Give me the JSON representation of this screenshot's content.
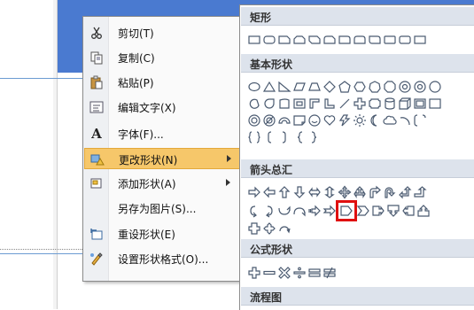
{
  "context_menu": {
    "items": [
      {
        "icon": "cut-icon",
        "label": "剪切(T)"
      },
      {
        "icon": "copy-icon",
        "label": "复制(C)"
      },
      {
        "icon": "paste-icon",
        "label": "粘贴(P)"
      },
      {
        "icon": "edit-text-icon",
        "label": "编辑文字(X)"
      },
      {
        "icon": "font-icon",
        "label": "字体(F)..."
      },
      {
        "icon": "change-shape-icon",
        "label": "更改形状(N)",
        "highlighted": true,
        "submenu": true
      },
      {
        "icon": "add-shape-icon",
        "label": "添加形状(A)",
        "submenu": true
      },
      {
        "icon": "",
        "label": "另存为图片(S)..."
      },
      {
        "icon": "reset-shape-icon",
        "label": "重设形状(E)"
      },
      {
        "icon": "format-shape-icon",
        "label": "设置形状格式(O)..."
      }
    ],
    "font_icon_glyph": "A"
  },
  "gallery": {
    "sections": [
      {
        "title": "矩形"
      },
      {
        "title": "基本形状"
      },
      {
        "title": "箭头总汇"
      },
      {
        "title": "公式形状"
      },
      {
        "title": "流程图"
      }
    ],
    "selected_shape": "pentagon-arrow-icon"
  },
  "colors": {
    "highlight": "#f6c76a",
    "header_bg": "#dde3ec",
    "selection_border": "#e01010",
    "slide_blue": "#4a7ad0"
  }
}
